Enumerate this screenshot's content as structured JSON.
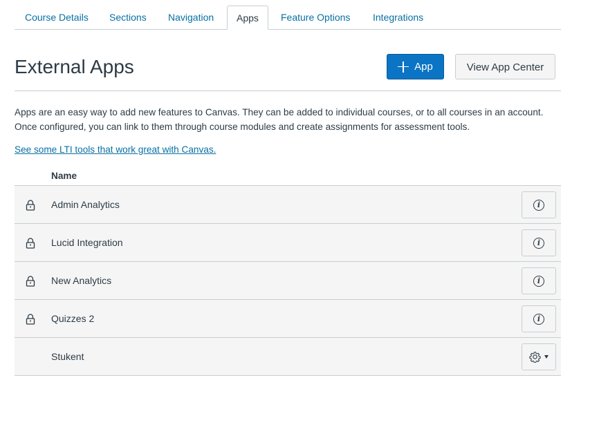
{
  "tabs": [
    {
      "label": "Course Details"
    },
    {
      "label": "Sections"
    },
    {
      "label": "Navigation"
    },
    {
      "label": "Apps",
      "active": true
    },
    {
      "label": "Feature Options"
    },
    {
      "label": "Integrations"
    }
  ],
  "header": {
    "title": "External Apps",
    "add_app_label": "App",
    "view_app_center_label": "View App Center"
  },
  "description": "Apps are an easy way to add new features to Canvas. They can be added to individual courses, or to all courses in an account. Once configured, you can link to them through course modules and create assignments for assessment tools.",
  "lti_link_text": "See some LTI tools that work great with Canvas.",
  "table": {
    "column_name": "Name",
    "rows": [
      {
        "name": "Admin Analytics",
        "locked": true,
        "action": "info-icon"
      },
      {
        "name": "Lucid Integration",
        "locked": true,
        "action": "info-icon"
      },
      {
        "name": "New Analytics",
        "locked": true,
        "action": "info-icon"
      },
      {
        "name": "Quizzes 2",
        "locked": true,
        "action": "info-icon"
      },
      {
        "name": "Stukent",
        "locked": false,
        "action": "gear-icon"
      }
    ]
  },
  "icons": {
    "info_glyph": "i"
  },
  "colors": {
    "link": "#0770a3",
    "primary_button": "#0b74c4",
    "row_background": "#f5f5f5",
    "border": "#c7cdd1",
    "text": "#2d3b45"
  }
}
